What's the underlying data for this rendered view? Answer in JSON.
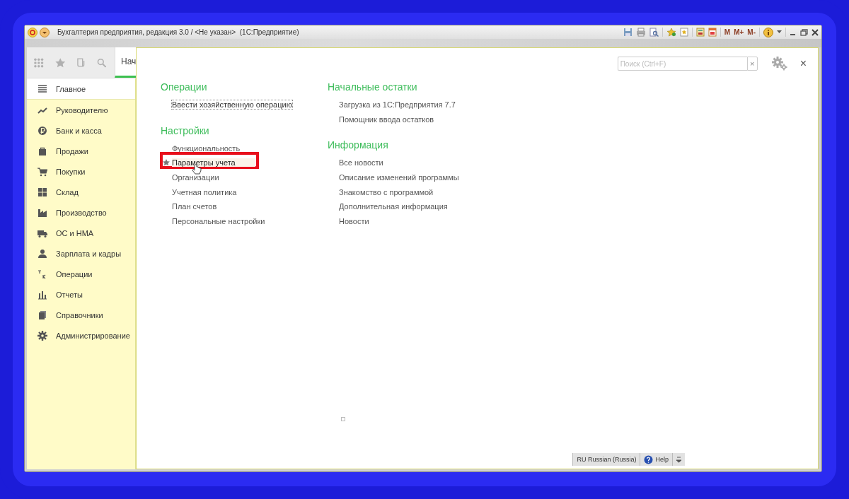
{
  "window": {
    "title": "Бухгалтерия предприятия, редакция 3.0 / <Не указан>  (1С:Предприятие)"
  },
  "memory_buttons": [
    "M",
    "M+",
    "M-"
  ],
  "tab": {
    "label": "Нач",
    "selected": true
  },
  "sidebar": {
    "items": [
      {
        "label": "Главное",
        "selected": true
      },
      {
        "label": "Руководителю",
        "selected": false
      },
      {
        "label": "Банк и касса",
        "selected": false
      },
      {
        "label": "Продажи",
        "selected": false
      },
      {
        "label": "Покупки",
        "selected": false
      },
      {
        "label": "Склад",
        "selected": false
      },
      {
        "label": "Производство",
        "selected": false
      },
      {
        "label": "ОС и НМА",
        "selected": false
      },
      {
        "label": "Зарплата и кадры",
        "selected": false
      },
      {
        "label": "Операции",
        "selected": false
      },
      {
        "label": "Отчеты",
        "selected": false
      },
      {
        "label": "Справочники",
        "selected": false
      },
      {
        "label": "Администрирование",
        "selected": false
      }
    ]
  },
  "search": {
    "placeholder": "Поиск (Ctrl+F)",
    "clear": "×"
  },
  "close": "×",
  "columns": [
    {
      "sections": [
        {
          "title": "Операции",
          "links": [
            {
              "label": "Ввести хозяйственную операцию",
              "focused": true,
              "highlighted": false
            }
          ]
        },
        {
          "title": "Настройки",
          "links": [
            {
              "label": "Функциональность",
              "focused": false,
              "highlighted": false
            },
            {
              "label": "Параметры учета",
              "focused": false,
              "highlighted": true
            },
            {
              "label": "Организации",
              "focused": false,
              "highlighted": false
            },
            {
              "label": "Учетная политика",
              "focused": false,
              "highlighted": false
            },
            {
              "label": "План счетов",
              "focused": false,
              "highlighted": false
            },
            {
              "label": "Персональные настройки",
              "focused": false,
              "highlighted": false
            }
          ]
        }
      ]
    },
    {
      "sections": [
        {
          "title": "Начальные остатки",
          "links": [
            {
              "label": "Загрузка из 1С:Предприятия 7.7",
              "focused": false,
              "highlighted": false
            },
            {
              "label": "Помощник ввода остатков",
              "focused": false,
              "highlighted": false
            }
          ]
        },
        {
          "title": "Информация",
          "links": [
            {
              "label": "Все новости",
              "focused": false,
              "highlighted": false
            },
            {
              "label": "Описание изменений программы",
              "focused": false,
              "highlighted": false
            },
            {
              "label": "Знакомство с программой",
              "focused": false,
              "highlighted": false
            },
            {
              "label": "Дополнительная информация",
              "focused": false,
              "highlighted": false
            },
            {
              "label": "Новости",
              "focused": false,
              "highlighted": false
            }
          ]
        }
      ]
    }
  ],
  "status_bar": {
    "language": "RU Russian (Russia)",
    "help": "Help"
  }
}
